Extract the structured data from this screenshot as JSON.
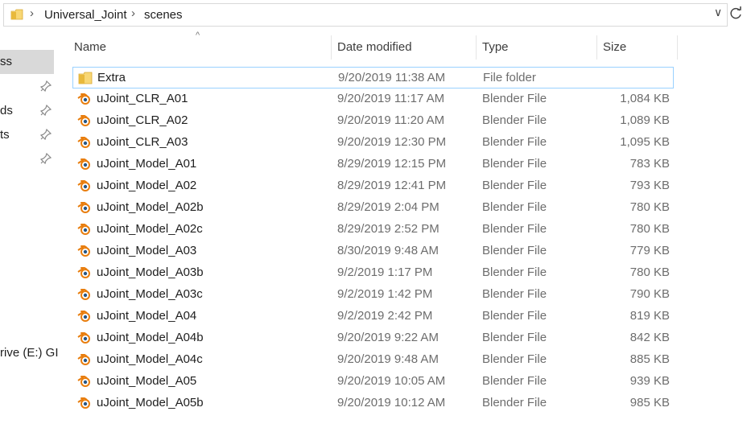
{
  "address": {
    "crumbs": [
      "Universal_Joint",
      "scenes"
    ]
  },
  "nav": {
    "items": [
      "ss",
      "ds",
      "ts",
      "rive (E:) GI"
    ]
  },
  "columns": {
    "name": "Name",
    "date": "Date modified",
    "type": "Type",
    "size": "Size"
  },
  "files": [
    {
      "name": "Extra",
      "date": "9/20/2019 11:38 AM",
      "type": "File folder",
      "size": "",
      "icon": "folder-icon"
    },
    {
      "name": "uJoint_CLR_A01",
      "date": "9/20/2019 11:17 AM",
      "type": "Blender File",
      "size": "1,084 KB",
      "icon": "blender-icon"
    },
    {
      "name": "uJoint_CLR_A02",
      "date": "9/20/2019 11:20 AM",
      "type": "Blender File",
      "size": "1,089 KB",
      "icon": "blender-icon"
    },
    {
      "name": "uJoint_CLR_A03",
      "date": "9/20/2019 12:30 PM",
      "type": "Blender File",
      "size": "1,095 KB",
      "icon": "blender-icon"
    },
    {
      "name": "uJoint_Model_A01",
      "date": "8/29/2019 12:15 PM",
      "type": "Blender File",
      "size": "783 KB",
      "icon": "blender-icon"
    },
    {
      "name": "uJoint_Model_A02",
      "date": "8/29/2019 12:41 PM",
      "type": "Blender File",
      "size": "793 KB",
      "icon": "blender-icon"
    },
    {
      "name": "uJoint_Model_A02b",
      "date": "8/29/2019 2:04 PM",
      "type": "Blender File",
      "size": "780 KB",
      "icon": "blender-icon"
    },
    {
      "name": "uJoint_Model_A02c",
      "date": "8/29/2019 2:52 PM",
      "type": "Blender File",
      "size": "780 KB",
      "icon": "blender-icon"
    },
    {
      "name": "uJoint_Model_A03",
      "date": "8/30/2019 9:48 AM",
      "type": "Blender File",
      "size": "779 KB",
      "icon": "blender-icon"
    },
    {
      "name": "uJoint_Model_A03b",
      "date": "9/2/2019 1:17 PM",
      "type": "Blender File",
      "size": "780 KB",
      "icon": "blender-icon"
    },
    {
      "name": "uJoint_Model_A03c",
      "date": "9/2/2019 1:42 PM",
      "type": "Blender File",
      "size": "790 KB",
      "icon": "blender-icon"
    },
    {
      "name": "uJoint_Model_A04",
      "date": "9/2/2019 2:42 PM",
      "type": "Blender File",
      "size": "819 KB",
      "icon": "blender-icon"
    },
    {
      "name": "uJoint_Model_A04b",
      "date": "9/20/2019 9:22 AM",
      "type": "Blender File",
      "size": "842 KB",
      "icon": "blender-icon"
    },
    {
      "name": "uJoint_Model_A04c",
      "date": "9/20/2019 9:48 AM",
      "type": "Blender File",
      "size": "885 KB",
      "icon": "blender-icon"
    },
    {
      "name": "uJoint_Model_A05",
      "date": "9/20/2019 10:05 AM",
      "type": "Blender File",
      "size": "939 KB",
      "icon": "blender-icon"
    },
    {
      "name": "uJoint_Model_A05b",
      "date": "9/20/2019 10:12 AM",
      "type": "Blender File",
      "size": "985 KB",
      "icon": "blender-icon"
    }
  ],
  "colors": {
    "selection_border": "#99d1ff",
    "folder_yellow": "#f8d775",
    "blender_orange": "#e87d0d",
    "blender_blue": "#265787"
  }
}
